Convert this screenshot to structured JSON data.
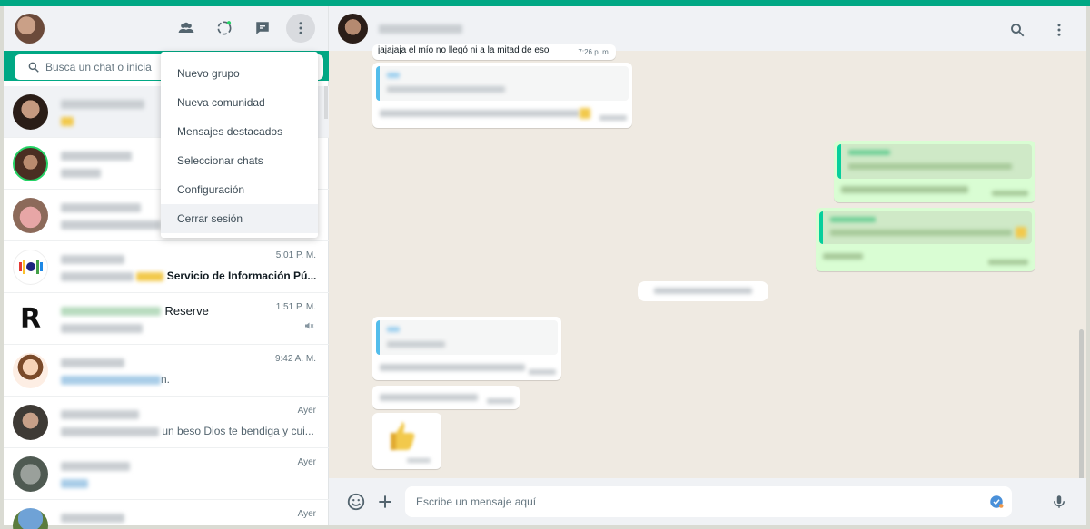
{
  "menu": {
    "items": [
      "Nuevo grupo",
      "Nueva comunidad",
      "Mensajes destacados",
      "Seleccionar chats",
      "Configuración",
      "Cerrar sesión"
    ]
  },
  "search": {
    "placeholder": "Busca un chat o inicia"
  },
  "chats": [
    {
      "time": "",
      "msg": ""
    },
    {
      "time": "",
      "msg": ""
    },
    {
      "time": "",
      "msg": ""
    },
    {
      "time": "5:01 P. M.",
      "msg": "Servicio de Información Pú..."
    },
    {
      "time": "1:51 P. M.",
      "name_suffix": "Reserve",
      "msg": ""
    },
    {
      "time": "9:42 A. M.",
      "msg": "n."
    },
    {
      "time": "Ayer",
      "msg": "un beso Dios te bendiga y cui..."
    },
    {
      "time": "Ayer",
      "msg": ""
    },
    {
      "time": "Ayer",
      "msg": ""
    }
  ],
  "conversation": {
    "first_msg_partial": "jajajaja el mío no llegó ni a la mitad de eso",
    "first_msg_time": "7:26 p. m."
  },
  "compose": {
    "placeholder": "Escribe un mensaje aquí"
  },
  "colors": {
    "accent": "#00a884",
    "outgoing": "#d9fdd3"
  }
}
